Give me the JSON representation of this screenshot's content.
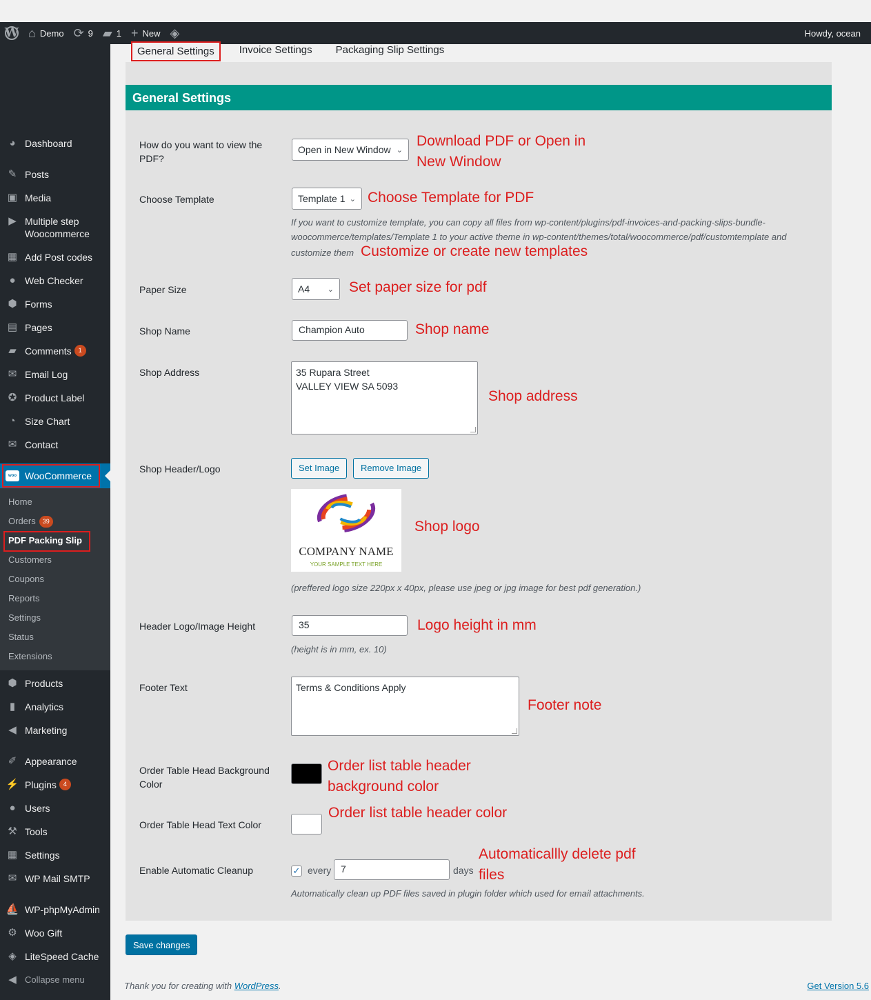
{
  "admin_bar": {
    "site_name": "Demo",
    "updates_count": "9",
    "comments_count": "1",
    "new_label": "New",
    "howdy": "Howdy, ocean"
  },
  "sidebar": {
    "items": [
      {
        "label": "Dashboard",
        "icon": "dashboard-icon"
      },
      {
        "label": "Posts",
        "icon": "pin-icon"
      },
      {
        "label": "Media",
        "icon": "media-icon"
      },
      {
        "label": "Multiple step Woocommerce",
        "icon": "arrow-icon"
      },
      {
        "label": "Add Post codes",
        "icon": "grid-icon"
      },
      {
        "label": "Web Checker",
        "icon": "globe-icon"
      },
      {
        "label": "Forms",
        "icon": "forms-icon"
      },
      {
        "label": "Pages",
        "icon": "pages-icon"
      },
      {
        "label": "Comments",
        "icon": "comment-icon",
        "badge": "1"
      },
      {
        "label": "Email Log",
        "icon": "email-icon"
      },
      {
        "label": "Product Label",
        "icon": "award-icon"
      },
      {
        "label": "Size Chart",
        "icon": "pie-icon"
      },
      {
        "label": "Contact",
        "icon": "envelope-icon"
      }
    ],
    "woocommerce_label": "WooCommerce",
    "woo_icon_text": "woo",
    "submenu": [
      {
        "label": "Home"
      },
      {
        "label": "Orders",
        "badge": "39"
      },
      {
        "label": "PDF Packing Slip"
      },
      {
        "label": "Customers"
      },
      {
        "label": "Coupons"
      },
      {
        "label": "Reports"
      },
      {
        "label": "Settings"
      },
      {
        "label": "Status"
      },
      {
        "label": "Extensions"
      }
    ],
    "items_after": [
      {
        "label": "Products",
        "icon": "box-icon"
      },
      {
        "label": "Analytics",
        "icon": "bar-chart-icon"
      },
      {
        "label": "Marketing",
        "icon": "megaphone-icon"
      },
      {
        "label": "Appearance",
        "icon": "brush-icon"
      },
      {
        "label": "Plugins",
        "icon": "plug-icon",
        "badge": "4"
      },
      {
        "label": "Users",
        "icon": "user-icon"
      },
      {
        "label": "Tools",
        "icon": "wrench-icon"
      },
      {
        "label": "Settings",
        "icon": "settings-icon"
      },
      {
        "label": "WP Mail SMTP",
        "icon": "mail-smtp-icon"
      },
      {
        "label": "WP-phpMyAdmin",
        "icon": "phpmyadmin-icon"
      },
      {
        "label": "Woo Gift",
        "icon": "gear-icon"
      },
      {
        "label": "LiteSpeed Cache",
        "icon": "diamond-icon"
      },
      {
        "label": "Collapse menu",
        "icon": "collapse-icon"
      }
    ]
  },
  "tabs": [
    "General Settings",
    "Invoice Settings",
    "Packaging Slip Settings"
  ],
  "section_title": "General Settings",
  "form": {
    "view_pdf": {
      "label": "How do you want to view the PDF?",
      "value": "Open in New Window",
      "annotation": "Download PDF or Open in New Window"
    },
    "template": {
      "label": "Choose Template",
      "value": "Template 1",
      "annotation": "Choose Template for PDF",
      "hint": "If you want to customize template, you can copy all files from wp-content/plugins/pdf-invoices-and-packing-slips-bundle-woocommerce/templates/Template 1 to your active theme in wp-content/themes/total/woocommerce/pdf/customtemplate and customize them",
      "hint_annotation": "Customize or create new templates"
    },
    "paper_size": {
      "label": "Paper Size",
      "value": "A4",
      "annotation": "Set paper size for pdf"
    },
    "shop_name": {
      "label": "Shop Name",
      "value": "Champion Auto",
      "annotation": "Shop name"
    },
    "shop_address": {
      "label": "Shop Address",
      "value": "35 Rupara Street\nVALLEY VIEW SA 5093",
      "annotation": "Shop address"
    },
    "shop_logo": {
      "label": "Shop Header/Logo",
      "set_label": "Set Image",
      "remove_label": "Remove Image",
      "annotation": "Shop logo",
      "logo_company": "COMPANY NAME",
      "logo_tagline": "YOUR SAMPLE TEXT HERE",
      "hint": "(preffered logo size 220px x 40px, please use jpeg or jpg image for best pdf generation.)"
    },
    "logo_height": {
      "label": "Header Logo/Image Height",
      "value": "35",
      "annotation": "Logo height in mm",
      "hint": "(height is in mm, ex. 10)"
    },
    "footer_text": {
      "label": "Footer Text",
      "value": "Terms & Conditions Apply",
      "annotation": "Footer note"
    },
    "head_bg_color": {
      "label": "Order Table Head Background Color",
      "color": "#000000",
      "annotation": "Order list table header background color"
    },
    "head_text_color": {
      "label": "Order Table Head Text Color",
      "color": "#ffffff",
      "annotation": "Order list table header color"
    },
    "cleanup": {
      "label": "Enable Automatic Cleanup",
      "checked": true,
      "every_label": "every",
      "value": "7",
      "days_label": "days",
      "annotation": "Automaticallly delete pdf files",
      "hint": "Automatically clean up PDF files saved in plugin folder which used for email attachments."
    }
  },
  "save_label": "Save changes",
  "footer": {
    "thanks_prefix": "Thank you for creating with",
    "wordpress_link": "WordPress",
    "thanks_suffix": ".",
    "version_link": "Get Version 5.6"
  },
  "colors": {
    "accent": "#009688",
    "wp_blue": "#0073aa",
    "annotation_red": "#dc1e1e"
  }
}
